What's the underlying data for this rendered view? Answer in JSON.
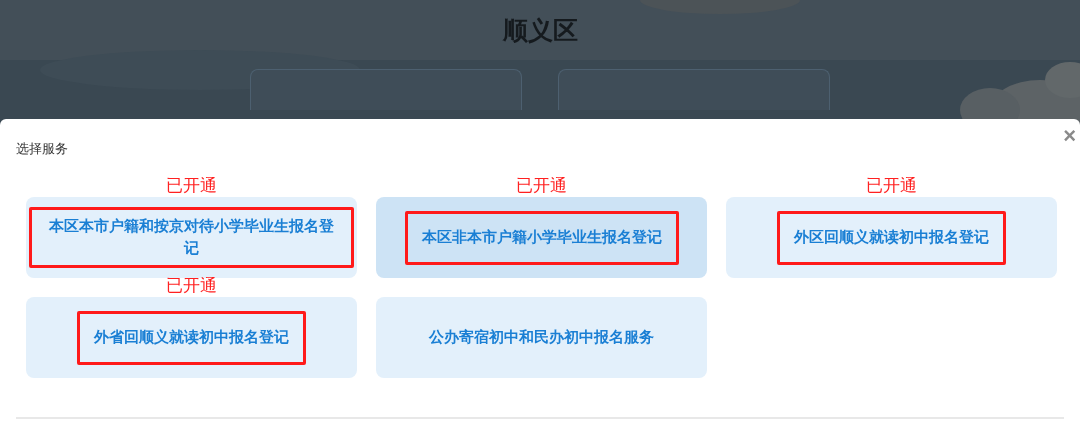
{
  "page": {
    "title": "顺义区"
  },
  "dialog": {
    "title": "选择服务",
    "close": "×",
    "services": [
      {
        "label": "本区本市户籍和按京对待小学毕业生报名登记",
        "selected": false,
        "annotation": "已开通"
      },
      {
        "label": "本区非本市户籍小学毕业生报名登记",
        "selected": true,
        "annotation": "已开通"
      },
      {
        "label": "外区回顺义就读初中报名登记",
        "selected": false,
        "annotation": "已开通"
      },
      {
        "label": "外省回顺义就读初中报名登记",
        "selected": false,
        "annotation": "已开通"
      },
      {
        "label": "公办寄宿初中和民办初中报名服务",
        "selected": false
      }
    ]
  }
}
